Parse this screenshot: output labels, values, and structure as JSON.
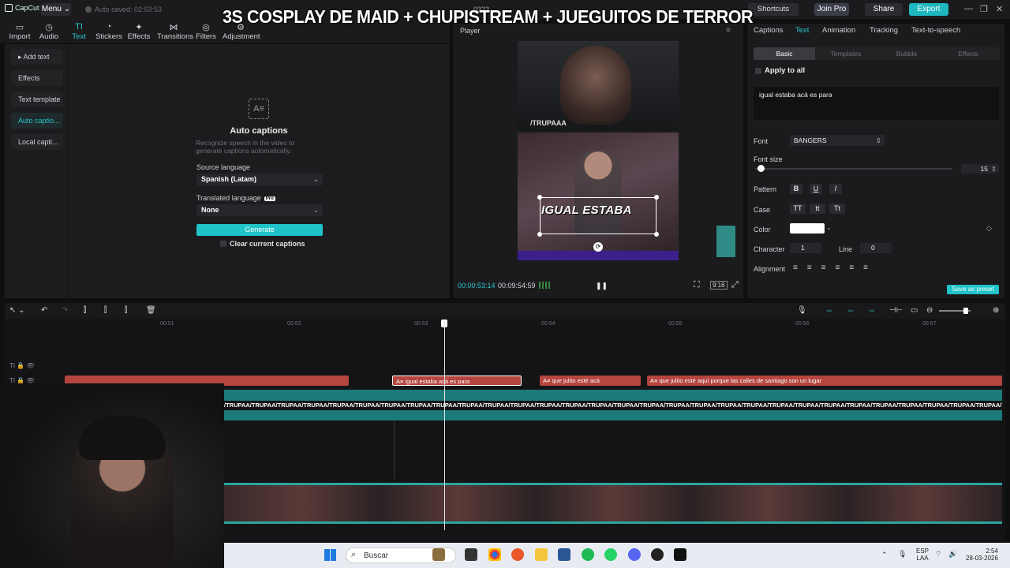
{
  "titlebar": {
    "app_name": "CapCut",
    "menu": "Menu",
    "autosave": "Auto saved: 02:53:53",
    "project_no": "0323",
    "shortcuts": "Shortcuts",
    "join_pro": "Join Pro",
    "share": "Share",
    "export": "Export"
  },
  "overlay_title": "3S COSPLAY DE MAID + CHUPISTREAM + JUEGUITOS DE TERROR",
  "toolbar": {
    "items": [
      {
        "label": "Import",
        "icon": "import-icon"
      },
      {
        "label": "Audio",
        "icon": "audio-icon"
      },
      {
        "label": "Text",
        "icon": "text-icon"
      },
      {
        "label": "Stickers",
        "icon": "stickers-icon"
      },
      {
        "label": "Effects",
        "icon": "effects-icon"
      },
      {
        "label": "Transitions",
        "icon": "transitions-icon"
      },
      {
        "label": "Filters",
        "icon": "filters-icon"
      },
      {
        "label": "Adjustment",
        "icon": "adjustment-icon"
      }
    ]
  },
  "left_nav": [
    "Add text",
    "Effects",
    "Text template",
    "Auto captio...",
    "Local capti..."
  ],
  "auto_captions": {
    "title": "Auto captions",
    "description": "Recognize speech in the video to generate captions automatically.",
    "source_label": "Source language",
    "source_value": "Spanish (Latam)",
    "translated_label": "Translated language",
    "pro_badge": "Pro",
    "translated_value": "None",
    "generate": "Generate",
    "clear": "Clear current captions"
  },
  "player": {
    "label": "Player",
    "watermark": "/TRUPAAA",
    "caption": "IGUAL ESTABA",
    "time_current": "00:00:53:14",
    "time_total": "00:09:54:59",
    "ratio": "9:16"
  },
  "right_panel": {
    "tabs": [
      "Captions",
      "Text",
      "Animation",
      "Tracking",
      "Text-to-speech"
    ],
    "subtabs": [
      "Basic",
      "Templates",
      "Bubble",
      "Effects"
    ],
    "apply_all": "Apply to all",
    "text_value": "igual estaba acá es para",
    "font_label": "Font",
    "font_value": "BANGERS",
    "font_size_label": "Font size",
    "font_size_value": "15",
    "font_size_fraction": 0.02,
    "pattern_label": "Pattern",
    "pattern_buttons": [
      "B",
      "U",
      "I"
    ],
    "case_label": "Case",
    "case_buttons": [
      "TT",
      "tt",
      "Tt"
    ],
    "color_label": "Color",
    "color_value": "#ffffff",
    "character_label": "Character",
    "character_value": "1",
    "line_label": "Line",
    "line_value": "0",
    "alignment_label": "Alignment",
    "save_preset": "Save as preset"
  },
  "timeline": {
    "ticks": [
      "00:51",
      "00:52",
      "00:53",
      "00:54",
      "00:55",
      "00:56",
      "00:57"
    ],
    "caption_clips": [
      "",
      "igual estaba acá es para",
      "que julito esté acá",
      "que julito esté aquí porque las calles de santiago son un lugar"
    ],
    "audio_clip_text": "/TRUPAA/TRUPAA/TRUPAA/TRUPAA/TRUPAA/TRUPAA/TRUPAA/TRUPAA/TRUPAA/TRUPAA/TRUPAA/TRUPAA/TRUPAA/TRUPAA/TRUPAA/TRUPAA/TRUPAA/TRUPAA/TRUPAA/TRUPAA/TRUPAA/TRUPAA/TRUPAA/TRUPAA/TRUPAA/TRUPAA/TRUPAA/TRUPAA/TRUPAA/TRUPAA/TRUPAA"
  },
  "taskbar": {
    "search": "Buscar",
    "lang1": "ESP",
    "lang2": "LAA",
    "time": "2:54",
    "date": "28-03-2026"
  },
  "colors": {
    "accent": "#29c6cf",
    "caption_clip": "#b5453f",
    "audio_track": "#1c7a78"
  }
}
